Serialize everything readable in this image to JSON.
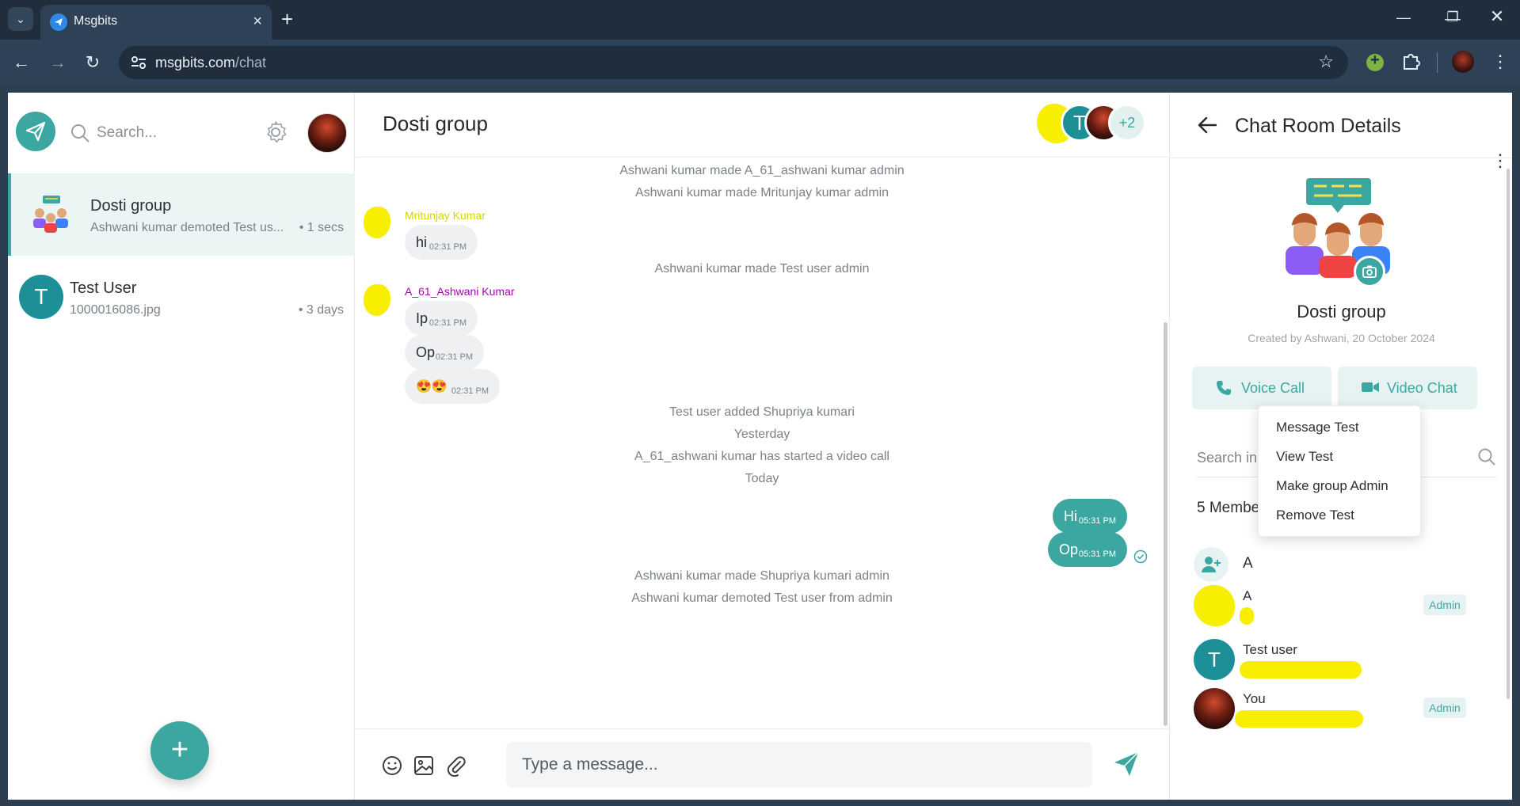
{
  "browser": {
    "tab_title": "Msgbits",
    "url_host": "msgbits.com",
    "url_path": "/chat"
  },
  "sidebar": {
    "search_placeholder": "Search...",
    "conversations": [
      {
        "name": "Dosti group",
        "snippet": "Ashwani kumar demoted Test us...",
        "time": "• 1 secs",
        "active": true
      },
      {
        "name": "Test User",
        "initial": "T",
        "snippet": "1000016086.jpg",
        "time": "• 3 days",
        "active": false
      }
    ],
    "fab_label": "+"
  },
  "chat": {
    "title": "Dosti group",
    "header_avatars": {
      "teal_initial": "T",
      "more_count": "+2"
    },
    "messages": [
      {
        "kind": "system",
        "text": "Ashwani kumar made A_61_ashwani kumar admin"
      },
      {
        "kind": "system",
        "text": "Ashwani kumar made Mritunjay kumar admin"
      },
      {
        "kind": "sender",
        "name": "Mritunjay Kumar",
        "color": "#d9d400"
      },
      {
        "kind": "incoming",
        "text": "hi",
        "time": "02:31 PM"
      },
      {
        "kind": "system",
        "text": "Ashwani kumar made Test user admin"
      },
      {
        "kind": "sender",
        "name": "A_61_Ashwani Kumar",
        "color": "#b000b5"
      },
      {
        "kind": "incoming",
        "text": "Ip",
        "time": "02:31 PM"
      },
      {
        "kind": "incoming",
        "text": "Op",
        "time": "02:31 PM"
      },
      {
        "kind": "incoming",
        "text": "😍😍",
        "time": "02:31 PM"
      },
      {
        "kind": "system",
        "text": "Test user added Shupriya kumari"
      },
      {
        "kind": "system",
        "text": "Yesterday"
      },
      {
        "kind": "system",
        "text": "A_61_ashwani kumar has started a video call"
      },
      {
        "kind": "system",
        "text": "Today"
      },
      {
        "kind": "outgoing",
        "text": "Hi",
        "time": "05:31 PM"
      },
      {
        "kind": "outgoing",
        "text": "Op",
        "time": "05:31 PM"
      },
      {
        "kind": "system",
        "text": "Ashwani kumar made Shupriya kumari admin"
      },
      {
        "kind": "system",
        "text": "Ashwani kumar demoted Test user from admin"
      }
    ],
    "composer_placeholder": "Type a message..."
  },
  "details": {
    "title": "Chat Room Details",
    "group_name": "Dosti group",
    "created": "Created by Ashwani, 20 October 2024",
    "voice_call": "Voice Call",
    "video_chat": "Video Chat",
    "search_placeholder": "Search in Conversation",
    "members_label": "5 Membe",
    "add_member_label": "A",
    "members": [
      {
        "name": "A",
        "admin": "Admin"
      },
      {
        "name": "Test user",
        "initial": "T"
      },
      {
        "name": "You",
        "admin": "Admin"
      }
    ]
  },
  "context_menu": {
    "items": [
      "Message Test",
      "View Test",
      "Make group Admin",
      "Remove Test"
    ]
  },
  "colors": {
    "accent": "#3ba7a0",
    "redaction": "#f7ee00"
  }
}
